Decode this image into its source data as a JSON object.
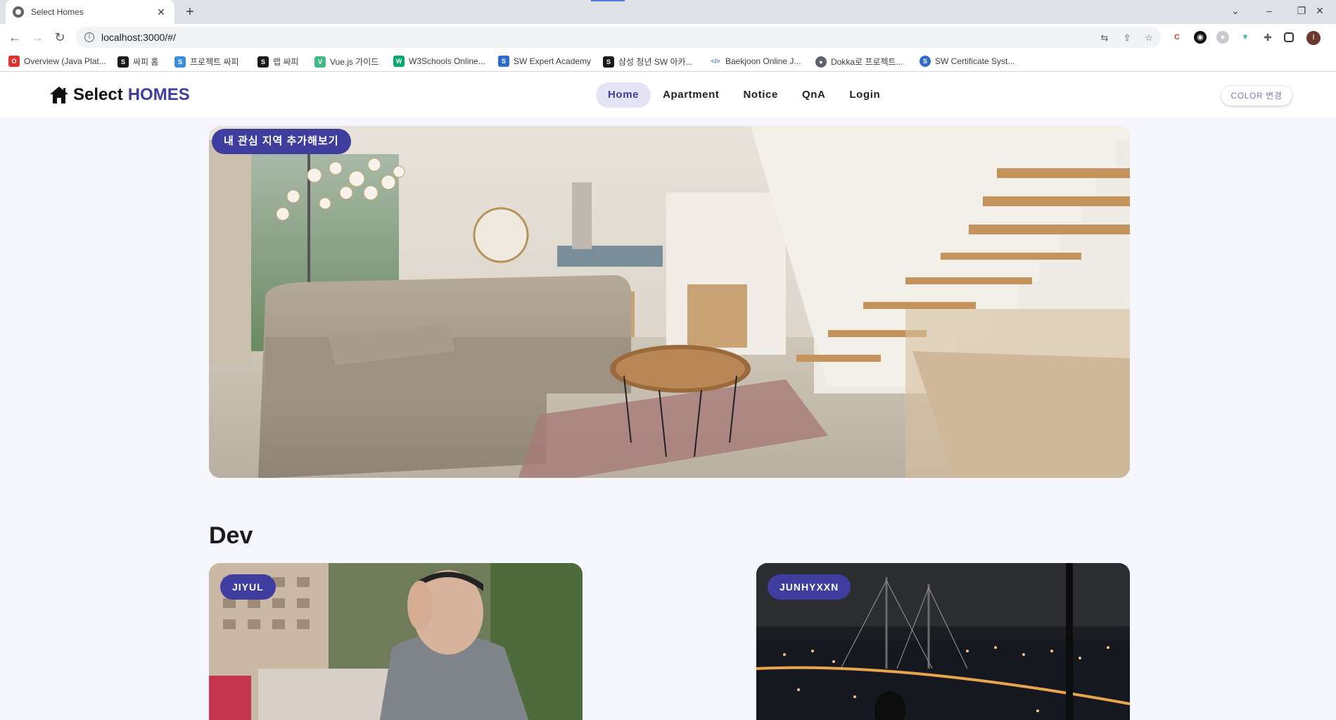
{
  "browser": {
    "tab_title": "Select Homes",
    "new_tab_symbol": "+",
    "url": "localhost:3000/#/",
    "bookmarks": [
      {
        "label": "Overview (Java Plat...",
        "icon": "oracle-icon",
        "color": "#e0312f"
      },
      {
        "label": "싸피 홈",
        "icon": "ssafy-icon",
        "color": "#1a1a1a"
      },
      {
        "label": "프로젝트 싸피",
        "icon": "ssafy-project-icon",
        "color": "#3a8fd8"
      },
      {
        "label": "랩 싸피",
        "icon": "ssafy-lab-icon",
        "color": "#1a1a1a"
      },
      {
        "label": "Vue.js 가이드",
        "icon": "vue-icon",
        "color": "#42b883"
      },
      {
        "label": "W3Schools Online...",
        "icon": "w3schools-icon",
        "color": "#04aa6d"
      },
      {
        "label": "SW Expert Academy",
        "icon": "swea-icon",
        "color": "#2e6ad1"
      },
      {
        "label": "삼성 청년 SW 아카...",
        "icon": "ssafy-academy-icon",
        "color": "#1a1a1a"
      },
      {
        "label": "Baekjoon Online J...",
        "icon": "baekjoon-icon",
        "color": "#4a7fe0"
      },
      {
        "label": "Dokka로 프로젝트...",
        "icon": "globe-icon",
        "color": "#5f6368"
      },
      {
        "label": "SW Certificate Syst...",
        "icon": "sw-certificate-icon",
        "color": "#2e6ad1"
      }
    ]
  },
  "site": {
    "logo_word": "Select",
    "logo_accent": "HOMES",
    "nav": [
      {
        "label": "Home",
        "active": true
      },
      {
        "label": "Apartment",
        "active": false
      },
      {
        "label": "Notice",
        "active": false
      },
      {
        "label": "QnA",
        "active": false
      },
      {
        "label": "Login",
        "active": false
      }
    ],
    "color_button": "COLOR 변경",
    "accent_color": "#3f3d9e"
  },
  "hero": {
    "badge": "내 관심 지역 추가해보기"
  },
  "dev": {
    "title": "Dev",
    "cards": [
      {
        "name": "JIYUL"
      },
      {
        "name": "JUNHYXXN"
      }
    ]
  }
}
